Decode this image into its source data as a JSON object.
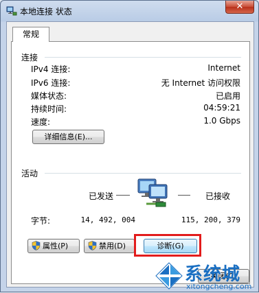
{
  "window": {
    "title": "本地连接 状态",
    "close_label": "✕"
  },
  "tab": {
    "label": "常规"
  },
  "connection": {
    "group_label": "连接",
    "rows": [
      {
        "label": "IPv4 连接:",
        "value": "Internet"
      },
      {
        "label": "IPv6 连接:",
        "value": "无 Internet 访问权限"
      },
      {
        "label": "媒体状态:",
        "value": "已启用"
      },
      {
        "label": "持续时间:",
        "value": "04:59:21"
      },
      {
        "label": "速度:",
        "value": "1.0 Gbps"
      }
    ],
    "details_button": "详细信息(E)..."
  },
  "activity": {
    "group_label": "活动",
    "sent_label": "已发送",
    "received_label": "已接收",
    "bytes_label": "字节:",
    "bytes_sent": "14, 492, 004",
    "bytes_received": "115, 200, 379"
  },
  "buttons": {
    "properties": "属性(P)",
    "disable": "禁用(D)",
    "diagnose": "诊断(G)",
    "close": "关闭(C)"
  },
  "watermark": {
    "text": "系统城",
    "url": "xitongcheng.com"
  }
}
